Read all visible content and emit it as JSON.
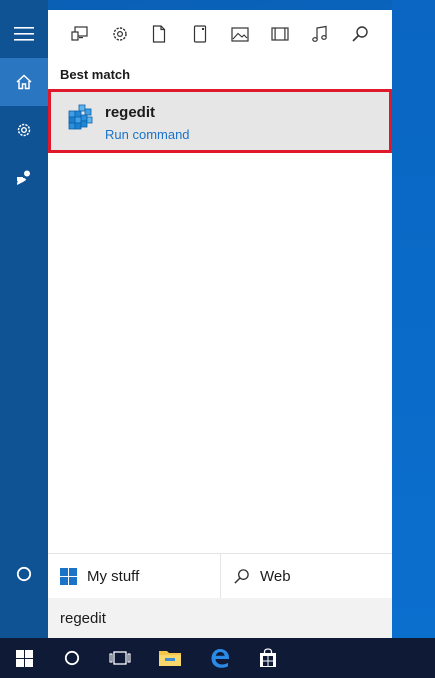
{
  "rail": {
    "items": [
      {
        "name": "hamburger-menu",
        "icon": "hamburger-icon"
      },
      {
        "name": "home",
        "icon": "home-icon",
        "active": true
      },
      {
        "name": "settings",
        "icon": "gear-icon"
      },
      {
        "name": "feedback",
        "icon": "feedback-icon"
      },
      {
        "name": "cortana",
        "icon": "cortana-ring-icon"
      }
    ]
  },
  "filters": [
    {
      "name": "apps",
      "icon": "apps-icon"
    },
    {
      "name": "settings",
      "icon": "gear-icon"
    },
    {
      "name": "documents",
      "icon": "document-icon"
    },
    {
      "name": "folders",
      "icon": "folder-icon"
    },
    {
      "name": "photos",
      "icon": "photo-icon"
    },
    {
      "name": "videos",
      "icon": "video-icon"
    },
    {
      "name": "music",
      "icon": "music-icon"
    },
    {
      "name": "web",
      "icon": "search-icon"
    }
  ],
  "results": {
    "section_label": "Best match",
    "best_match": {
      "title": "regedit",
      "subtitle": "Run command",
      "icon": "registry-cubes-icon"
    }
  },
  "scopes": {
    "my_stuff": "My stuff",
    "web": "Web"
  },
  "search": {
    "value": "regedit"
  },
  "taskbar": {
    "items": [
      "start-icon",
      "cortana-icon",
      "task-view-icon",
      "file-explorer-icon",
      "edge-icon",
      "store-icon"
    ]
  },
  "colors": {
    "rail": "#0f5395",
    "accent": "#2b76c0",
    "highlight_border": "#e0182c",
    "link": "#1a73c7",
    "taskbar": "#0e1a36"
  }
}
